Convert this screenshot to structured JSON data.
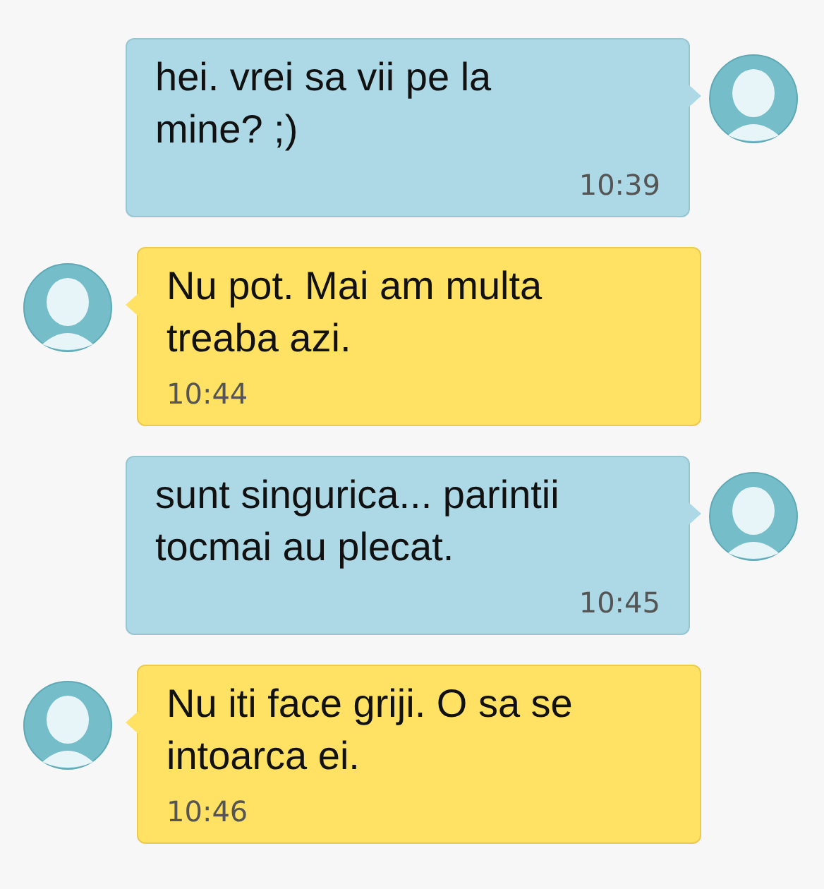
{
  "messages": [
    {
      "kind": "sent",
      "text": "hei. vrei sa vii pe la mine? ;)",
      "time": "10:39"
    },
    {
      "kind": "received",
      "text": "Nu pot. Mai am multa treaba azi.",
      "time": "10:44"
    },
    {
      "kind": "sent",
      "text": "sunt singurica... parintii tocmai au plecat.",
      "time": "10:45"
    },
    {
      "kind": "received",
      "text": "Nu iti face griji. O sa se intoarca ei.",
      "time": "10:46"
    }
  ]
}
